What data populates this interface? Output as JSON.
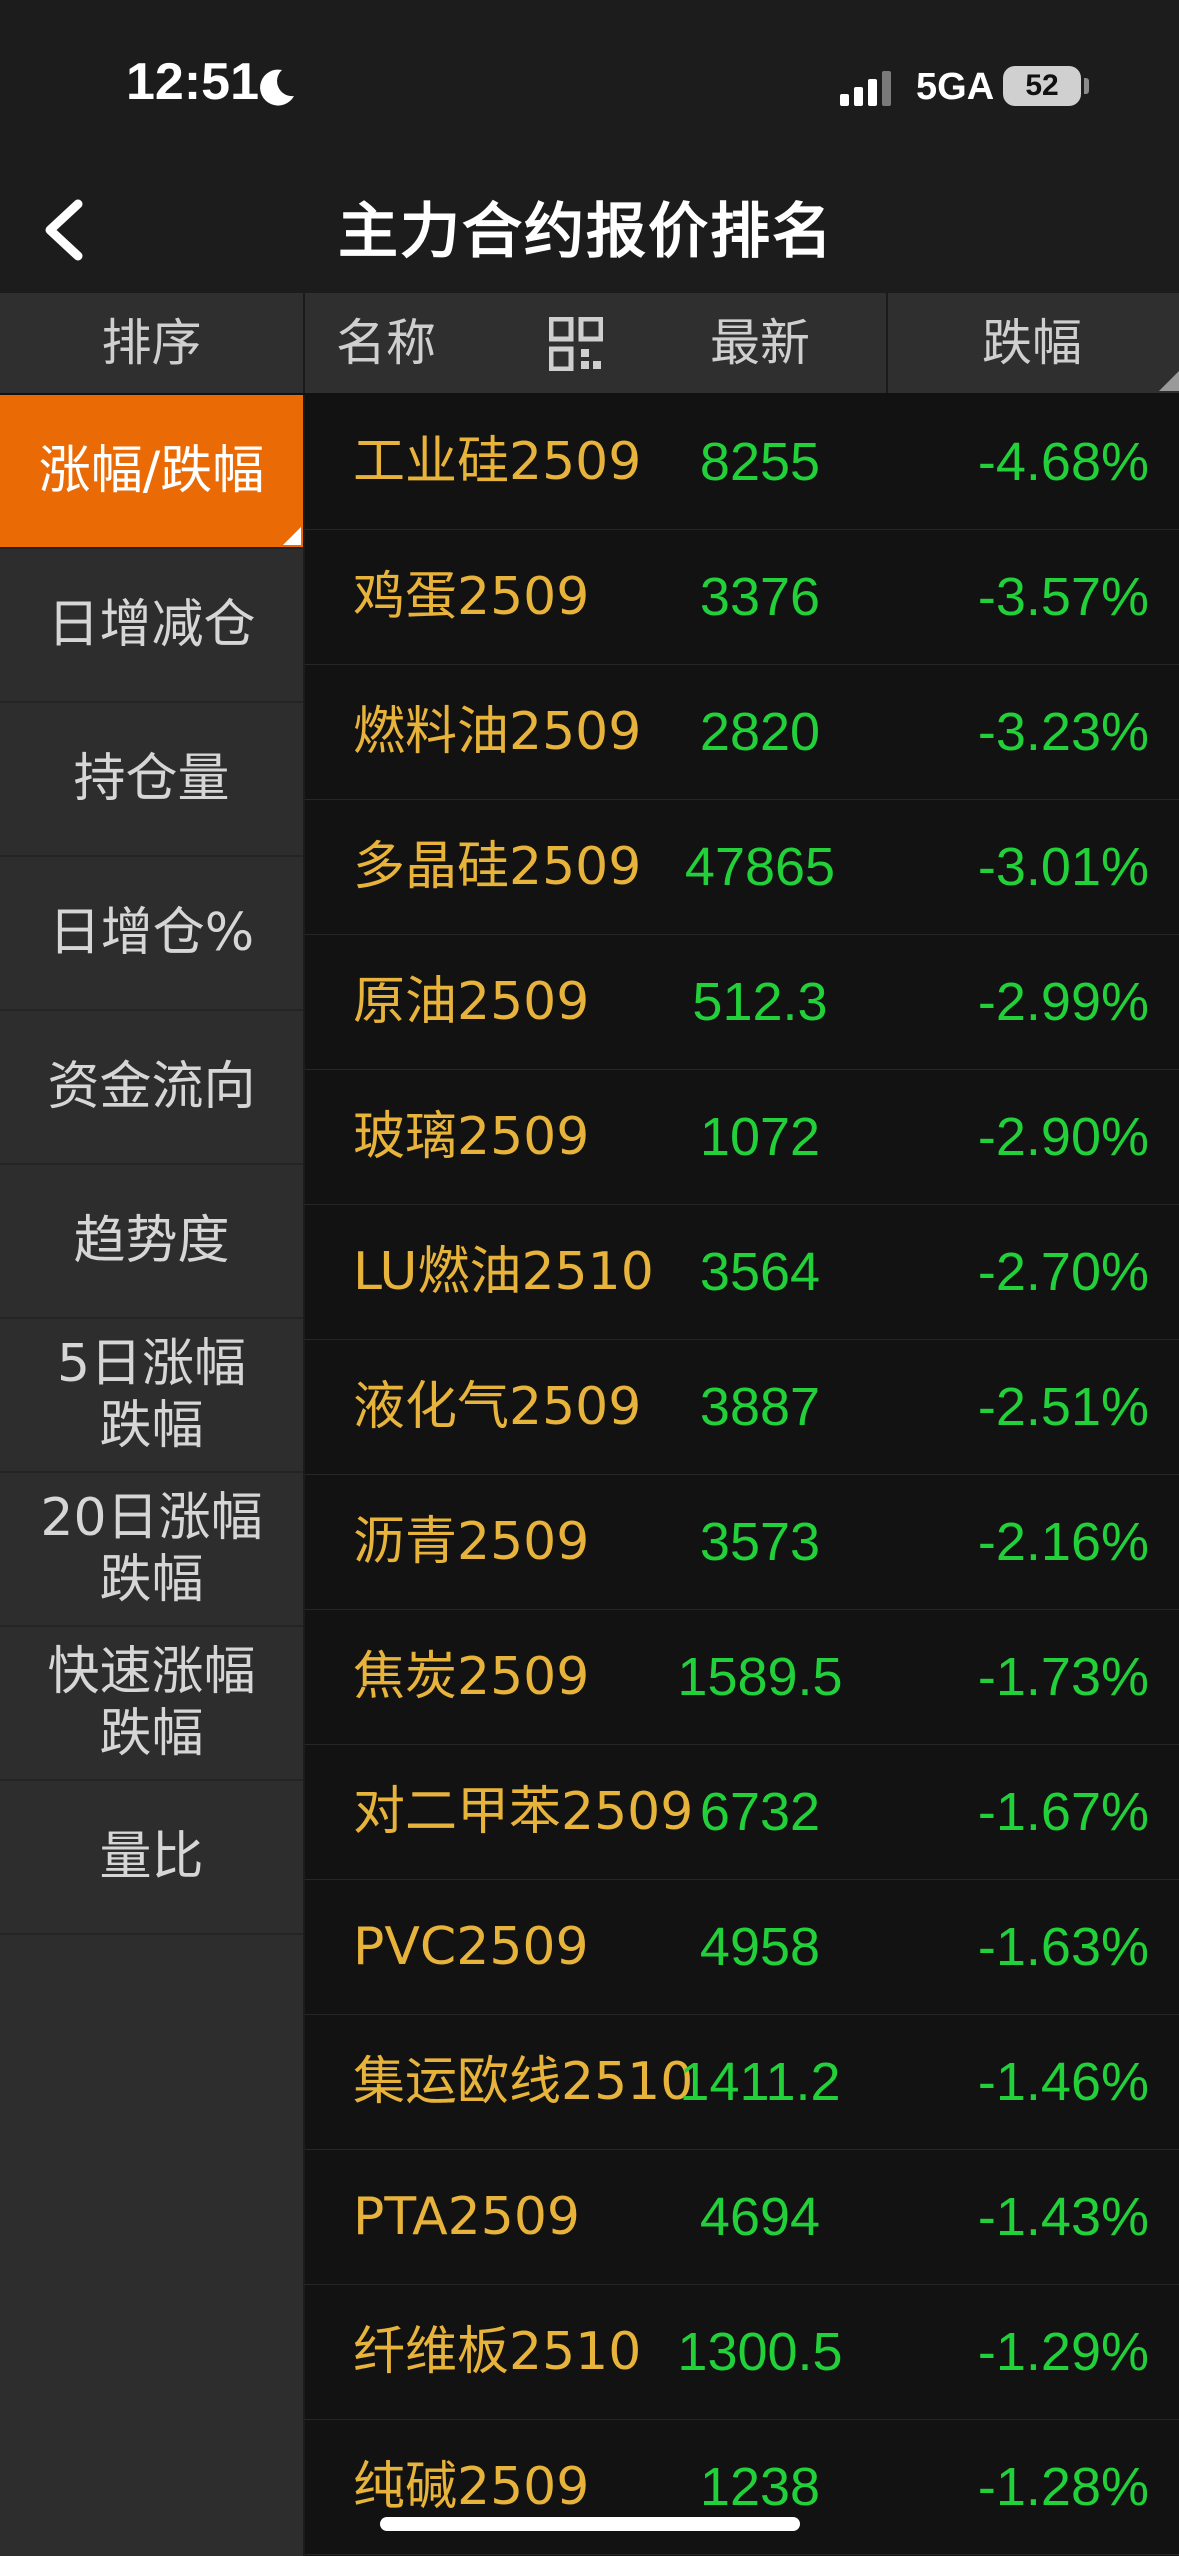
{
  "status_bar": {
    "time": "12:51",
    "network": "5GA",
    "battery": "52"
  },
  "nav": {
    "title": "主力合约报价排名"
  },
  "header": {
    "sort": "排序",
    "name": "名称",
    "latest": "最新",
    "change": "跌幅"
  },
  "sidebar": {
    "items": [
      {
        "label": "涨幅/跌幅",
        "active": true
      },
      {
        "label": "日增减仓"
      },
      {
        "label": "持仓量"
      },
      {
        "label": "日增仓%"
      },
      {
        "label": "资金流向"
      },
      {
        "label": "趋势度"
      },
      {
        "label": "5日涨幅\n跌幅"
      },
      {
        "label": "20日涨幅\n跌幅"
      },
      {
        "label": "快速涨幅\n跌幅"
      },
      {
        "label": "量比"
      }
    ]
  },
  "table": {
    "rows": [
      {
        "name": "工业硅2509",
        "latest": "8255",
        "change": "-4.68%"
      },
      {
        "name": "鸡蛋2509",
        "latest": "3376",
        "change": "-3.57%"
      },
      {
        "name": "燃料油2509",
        "latest": "2820",
        "change": "-3.23%"
      },
      {
        "name": "多晶硅2509",
        "latest": "47865",
        "change": "-3.01%"
      },
      {
        "name": "原油2509",
        "latest": "512.3",
        "change": "-2.99%"
      },
      {
        "name": "玻璃2509",
        "latest": "1072",
        "change": "-2.90%"
      },
      {
        "name": "LU燃油2510",
        "latest": "3564",
        "change": "-2.70%"
      },
      {
        "name": "液化气2509",
        "latest": "3887",
        "change": "-2.51%"
      },
      {
        "name": "沥青2509",
        "latest": "3573",
        "change": "-2.16%"
      },
      {
        "name": "焦炭2509",
        "latest": "1589.5",
        "change": "-1.73%"
      },
      {
        "name": "对二甲苯2509",
        "latest": "6732",
        "change": "-1.67%"
      },
      {
        "name": "PVC2509",
        "latest": "4958",
        "change": "-1.63%"
      },
      {
        "name": "集运欧线2510",
        "latest": "1411.2",
        "change": "-1.46%"
      },
      {
        "name": "PTA2509",
        "latest": "4694",
        "change": "-1.43%"
      },
      {
        "name": "纤维板2510",
        "latest": "1300.5",
        "change": "-1.29%"
      },
      {
        "name": "纯碱2509",
        "latest": "1238",
        "change": "-1.28%"
      }
    ]
  },
  "colors": {
    "accent": "#ea6b05",
    "name_text": "#e8b33a",
    "down": "#22d13a"
  }
}
